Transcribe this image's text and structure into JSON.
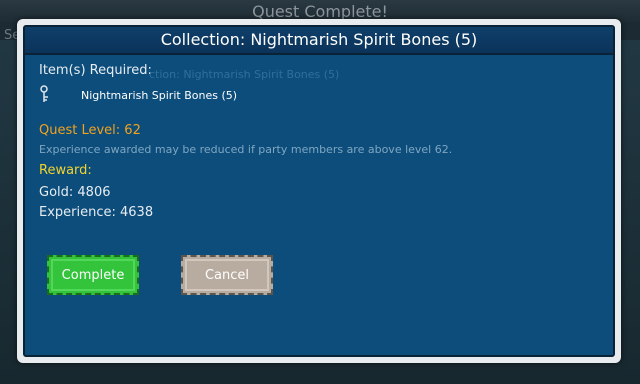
{
  "background": {
    "title": "Quest Complete!",
    "left_fragment": "Se",
    "ghost_text": "ction: Nightmarish Spirit Bones (5)"
  },
  "dialog": {
    "title": "Collection: Nightmarish Spirit Bones (5)",
    "items_required_label": "Item(s) Required:",
    "item_name": "Nightmarish Spirit Bones (5)",
    "item_icon": "key-icon",
    "quest_level_label": "Quest Level: 62",
    "experience_note": "Experience awarded may be reduced if party members are above level 62.",
    "reward_label": "Reward:",
    "gold_text": "Gold: 4806",
    "experience_text": "Experience: 4638",
    "complete_button": "Complete",
    "cancel_button": "Cancel"
  },
  "colors": {
    "dialog_blue": "#0d4d7c",
    "quest_level_orange": "#f2a21c",
    "reward_yellow": "#f3d42b",
    "complete_green": "#33c43b",
    "cancel_tan": "#b8aca0"
  }
}
